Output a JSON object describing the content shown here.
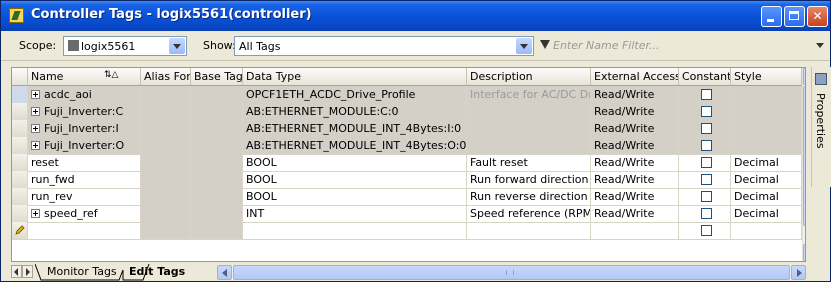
{
  "window": {
    "title": "Controller Tags - logix5561(controller)"
  },
  "toolbar": {
    "scope_label": "Scope:",
    "scope_value": "logix5561",
    "show_label": "Show:",
    "show_value": "All Tags",
    "filter_placeholder": "Enter Name Filter..."
  },
  "table": {
    "columns": [
      "Name",
      "Alias For",
      "Base Tag",
      "Data Type",
      "Description",
      "External Access",
      "Constant",
      "Style"
    ],
    "rows": [
      {
        "name": "acdc_aoi",
        "alias_for": "",
        "base_tag": "",
        "data_type": "OPCF1ETH_ACDC_Drive_Profile",
        "description": "Interface for AC/DC Dr...",
        "external_access": "Read/Write",
        "constant": false,
        "style": "",
        "expandable": true
      },
      {
        "name": "Fuji_Inverter:C",
        "alias_for": "",
        "base_tag": "",
        "data_type": "AB:ETHERNET_MODULE:C:0",
        "description": "",
        "external_access": "Read/Write",
        "constant": false,
        "style": "",
        "expandable": true
      },
      {
        "name": "Fuji_Inverter:I",
        "alias_for": "",
        "base_tag": "",
        "data_type": "AB:ETHERNET_MODULE_INT_4Bytes:I:0",
        "description": "",
        "external_access": "Read/Write",
        "constant": false,
        "style": "",
        "expandable": true
      },
      {
        "name": "Fuji_Inverter:O",
        "alias_for": "",
        "base_tag": "",
        "data_type": "AB:ETHERNET_MODULE_INT_4Bytes:O:0",
        "description": "",
        "external_access": "Read/Write",
        "constant": false,
        "style": "",
        "expandable": true
      },
      {
        "name": "reset",
        "alias_for": "",
        "base_tag": "",
        "data_type": "BOOL",
        "description": "Fault reset",
        "external_access": "Read/Write",
        "constant": false,
        "style": "Decimal",
        "expandable": false
      },
      {
        "name": "run_fwd",
        "alias_for": "",
        "base_tag": "",
        "data_type": "BOOL",
        "description": "Run forward direction",
        "external_access": "Read/Write",
        "constant": false,
        "style": "Decimal",
        "expandable": false
      },
      {
        "name": "run_rev",
        "alias_for": "",
        "base_tag": "",
        "data_type": "BOOL",
        "description": "Run reverse direction",
        "external_access": "Read/Write",
        "constant": false,
        "style": "Decimal",
        "expandable": false
      },
      {
        "name": "speed_ref",
        "alias_for": "",
        "base_tag": "",
        "data_type": "INT",
        "description": "Speed reference (RPM)",
        "external_access": "Read/Write",
        "constant": false,
        "style": "Decimal",
        "expandable": true
      }
    ]
  },
  "side_panel": {
    "properties_label": "Properties"
  },
  "tabs": [
    {
      "label": "Monitor Tags"
    },
    {
      "label": "Edit Tags"
    }
  ],
  "colors": {
    "title_bar": "#0a52da",
    "grid_gray": "#d4d0c8"
  }
}
